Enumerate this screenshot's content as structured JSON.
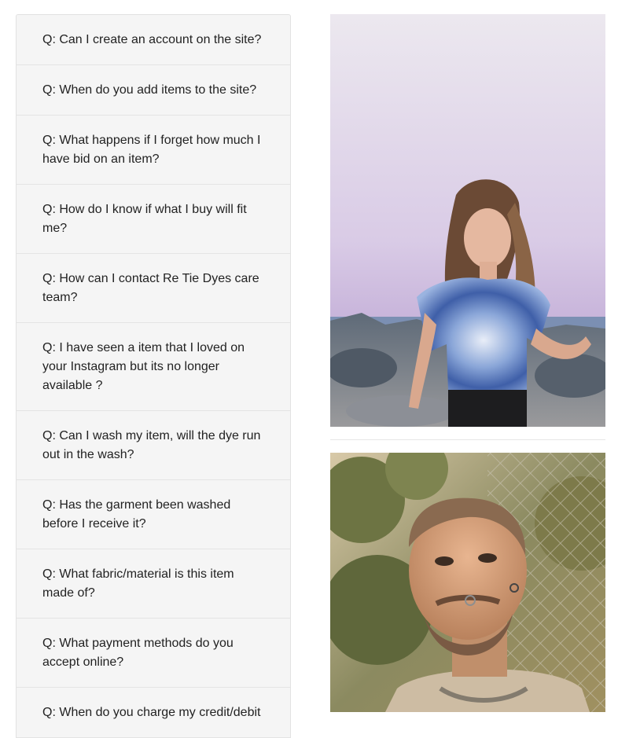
{
  "faq": {
    "items": [
      "Q: Can I create an account on the site?",
      "Q: When do you add items to the site?",
      "Q: What happens if I forget how much I have bid on an item?",
      "Q: How do I know if what I buy will fit me?",
      "Q: How can I contact Re Tie Dyes care team?",
      "Q: I have seen a item that I loved on your Instagram but its no longer available ?",
      "Q: Can I wash my item, will the dye run out in the wash?",
      "Q: Has the garment been washed before I receive it?",
      "Q: What fabric/material is this item made of?",
      "Q: What payment methods do you accept online?",
      "Q: When do you charge my credit/debit"
    ]
  },
  "photos": {
    "photo1_icon": "woman-in-tie-dye-shirt-photo",
    "photo2_icon": "man-portrait-photo"
  }
}
